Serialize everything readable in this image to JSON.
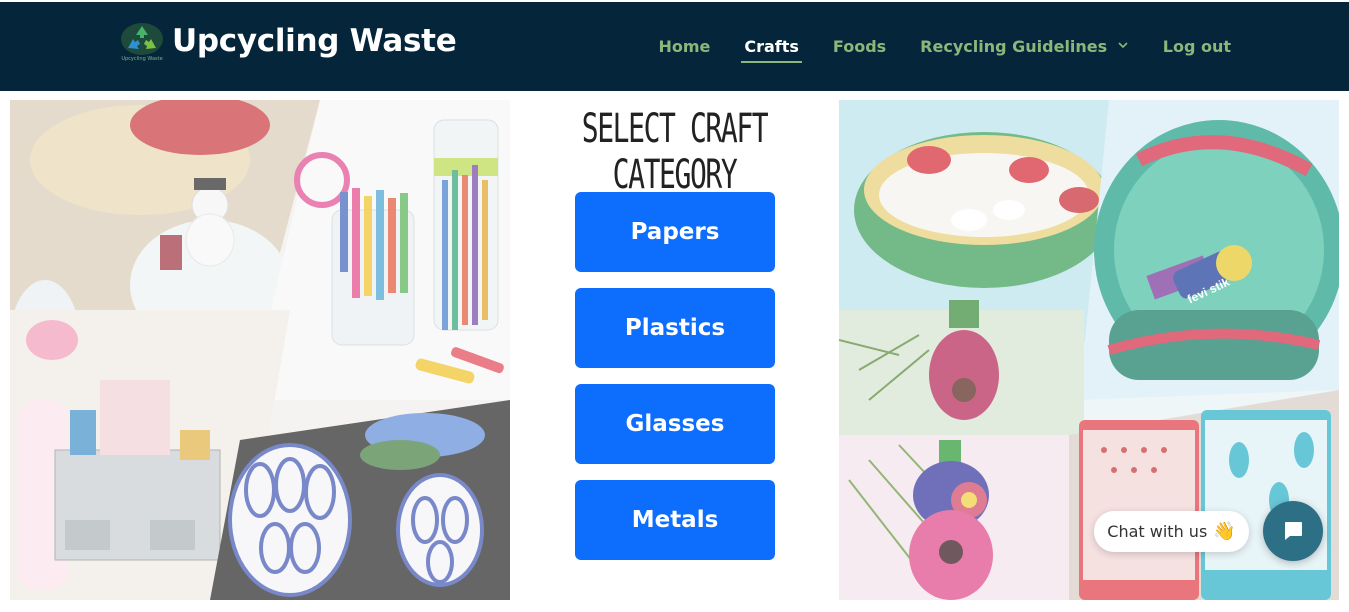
{
  "brand": {
    "title": "Upcycling Waste",
    "logo_caption": "Upcycling Waste",
    "logo_icon": "recycle-icon"
  },
  "nav": {
    "items": [
      {
        "label": "Home",
        "active": false
      },
      {
        "label": "Crafts",
        "active": true
      },
      {
        "label": "Foods",
        "active": false
      },
      {
        "label": "Recycling Guidelines",
        "active": false,
        "dropdown": true
      },
      {
        "label": "Log out",
        "active": false
      }
    ]
  },
  "main": {
    "heading": "Select Craft Category",
    "categories": [
      "Papers",
      "Plastics",
      "Glasses",
      "Metals"
    ],
    "left_image_text": "",
    "right_image_text": "fevi stik"
  },
  "chat": {
    "bubble_text": "Chat with us",
    "bubble_emoji": "👋",
    "button_icon": "chat-icon"
  },
  "colors": {
    "navbar_bg": "#05263a",
    "nav_link": "#8bb87a",
    "nav_active": "#ffffff",
    "button_bg": "#0d6efd",
    "chat_button": "#2d6f85"
  }
}
